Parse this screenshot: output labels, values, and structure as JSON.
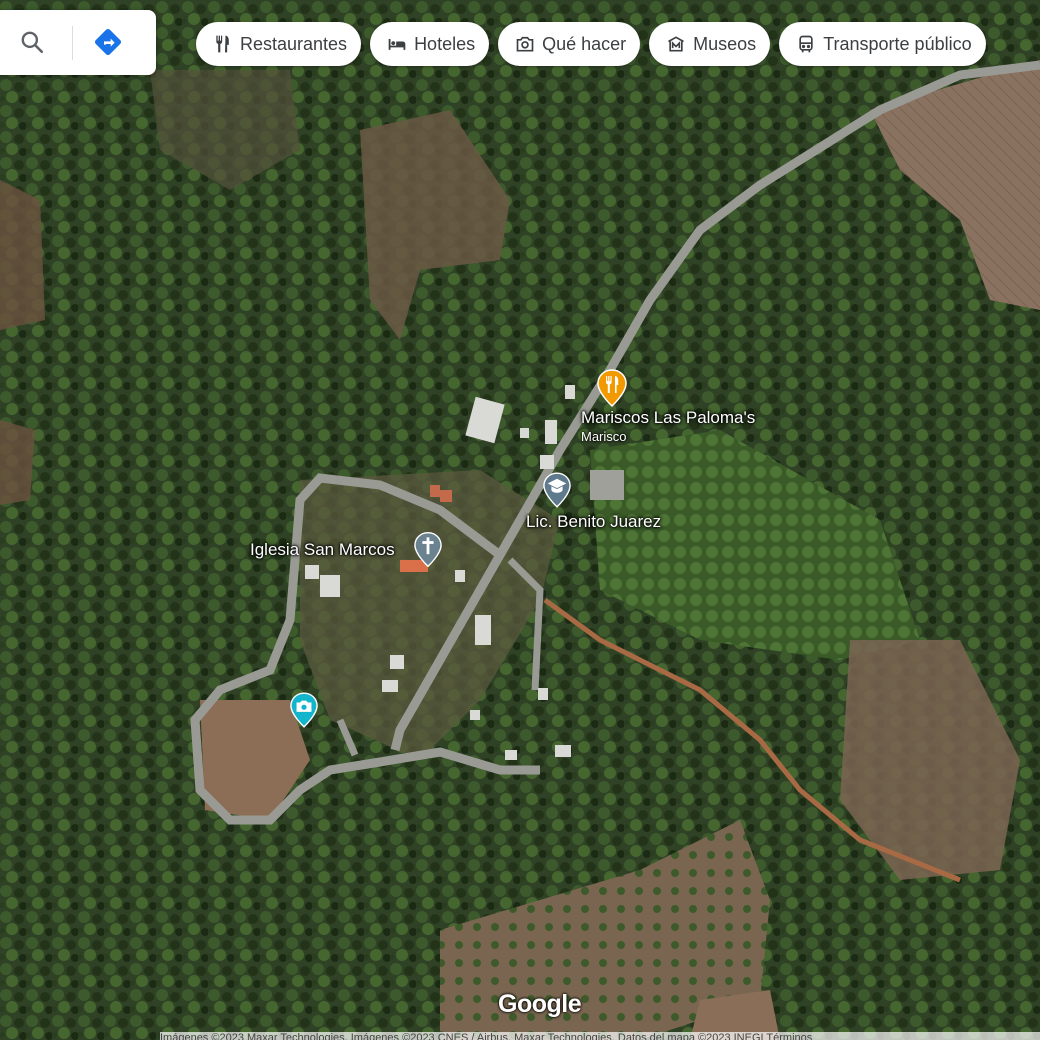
{
  "map": {
    "type": "satellite",
    "colors": {
      "forest": "#2f4225",
      "clearing": "#6e5a45",
      "road": "#9a9a94",
      "dirt_road": "#a86a45"
    }
  },
  "searchbox": {
    "search_icon": "search-icon",
    "directions_icon": "directions-icon",
    "directions_color": "#1a73e8"
  },
  "categories": [
    {
      "label": "Restaurantes",
      "icon": "fork-knife-icon"
    },
    {
      "label": "Hoteles",
      "icon": "bed-icon"
    },
    {
      "label": "Qué hacer",
      "icon": "camera-icon"
    },
    {
      "label": "Museos",
      "icon": "museum-icon"
    },
    {
      "label": "Transporte público",
      "icon": "bus-icon"
    }
  ],
  "places": {
    "restaurant": {
      "name": "Mariscos Las Paloma's",
      "category": "Marisco",
      "icon": "fork-knife-icon",
      "color": "#f29900"
    },
    "school": {
      "name": "Lic. Benito Juarez",
      "icon": "graduation-cap-icon",
      "color": "#5f7a8c"
    },
    "church": {
      "name": "Iglesia San Marcos",
      "icon": "cross-icon",
      "color": "#6b8290"
    },
    "viewpoint": {
      "icon": "camera-icon",
      "color": "#12b5cb"
    }
  },
  "branding": {
    "logo": "Google"
  },
  "attribution": "Imágenes ©2023 Maxar Technologies, Imágenes ©2023 CNES / Airbus, Maxar Technologies, Datos del mapa ©2023 INEGI   Términos"
}
